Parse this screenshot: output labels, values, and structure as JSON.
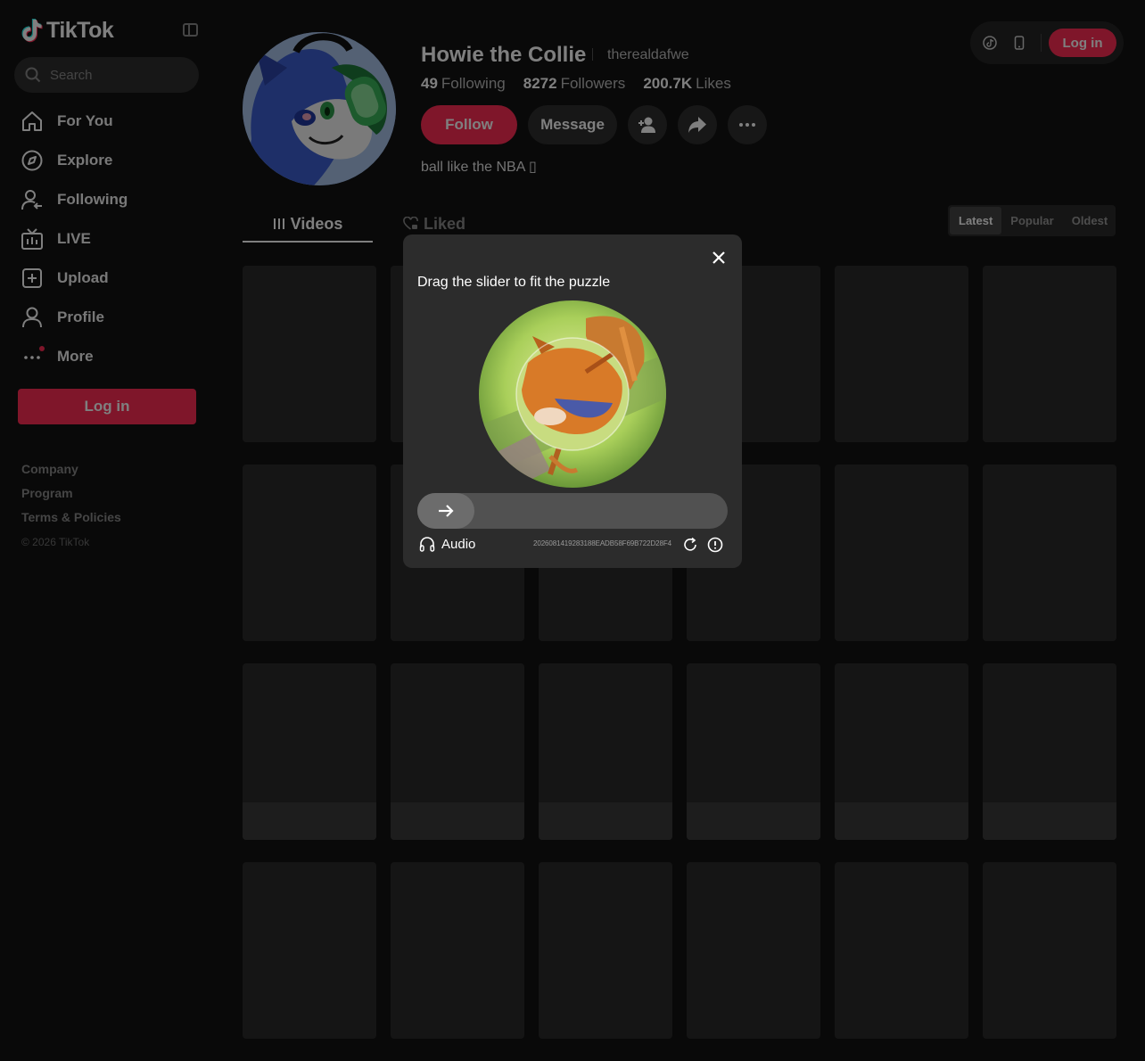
{
  "sidebar": {
    "brand": "TikTok",
    "search_placeholder": "Search",
    "nav": [
      {
        "label": "For You",
        "icon": "home-icon"
      },
      {
        "label": "Explore",
        "icon": "compass-icon"
      },
      {
        "label": "Following",
        "icon": "following-icon"
      },
      {
        "label": "LIVE",
        "icon": "live-icon"
      },
      {
        "label": "Upload",
        "icon": "upload-icon"
      },
      {
        "label": "Profile",
        "icon": "profile-icon"
      },
      {
        "label": "More",
        "icon": "more-icon"
      }
    ],
    "login_label": "Log in",
    "footer": {
      "company": "Company",
      "program": "Program",
      "terms": "Terms & Policies",
      "copyright": "© 2026 TikTok"
    }
  },
  "profile": {
    "display_name": "Howie the Collie",
    "handle": "therealdafwe",
    "following_count": "49",
    "following_label": "Following",
    "followers_count": "8272",
    "followers_label": "Followers",
    "likes_count": "200.7K",
    "likes_label": "Likes",
    "follow_label": "Follow",
    "message_label": "Message",
    "bio": "ball like the NBA ▯"
  },
  "topbar": {
    "login_label": "Log in"
  },
  "tabs": {
    "videos": "Videos",
    "liked": "Liked"
  },
  "sort": {
    "latest": "Latest",
    "popular": "Popular",
    "oldest": "Oldest"
  },
  "captcha": {
    "title": "Drag the slider to fit the puzzle",
    "audio_label": "Audio",
    "id": "2026081419283188EADB58F69B722D28F4",
    "slider_progress": 0
  },
  "colors": {
    "accent": "#fe2c55",
    "background": "#121212",
    "modal": "#2c2c2c"
  }
}
